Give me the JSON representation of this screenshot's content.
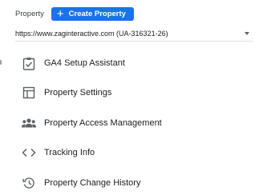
{
  "header": {
    "property_label": "Property",
    "create_button_label": "Create Property",
    "plus_glyph": "+"
  },
  "property_selector": {
    "selected_value": "https://www.zaginteractive.com (UA-316321-26)"
  },
  "menu": {
    "items": [
      {
        "label": "GA4 Setup Assistant",
        "icon": "checklist-icon"
      },
      {
        "label": "Property Settings",
        "icon": "layout-icon"
      },
      {
        "label": "Property Access Management",
        "icon": "people-icon"
      },
      {
        "label": "Tracking Info",
        "icon": "code-icon"
      },
      {
        "label": "Property Change History",
        "icon": "history-icon"
      }
    ]
  },
  "colors": {
    "accent": "#1a73e8",
    "icon": "#5f6368",
    "text": "#202124"
  }
}
